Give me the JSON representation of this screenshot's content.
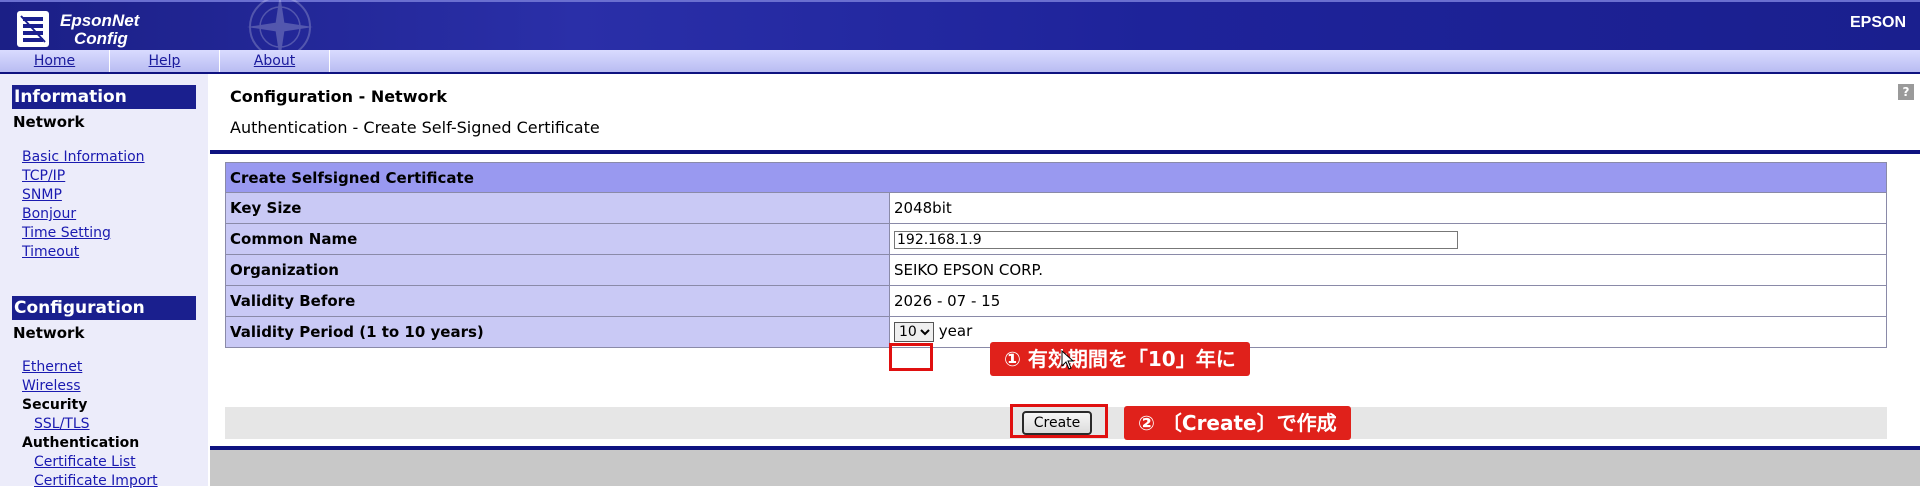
{
  "header": {
    "logo_line1": "EpsonNet",
    "logo_line2": "Config",
    "brand": "EPSON"
  },
  "nav": {
    "items": [
      {
        "label": "Home"
      },
      {
        "label": "Help"
      },
      {
        "label": "About"
      }
    ]
  },
  "sidebar": {
    "information": {
      "title": "Information",
      "section": "Network",
      "links": [
        "Basic Information",
        "TCP/IP",
        "SNMP",
        "Bonjour",
        "Time Setting",
        "Timeout"
      ]
    },
    "configuration": {
      "title": "Configuration",
      "section": "Network",
      "links": [
        "Ethernet",
        "Wireless"
      ],
      "security_label": "Security",
      "ssl_link": "SSL/TLS",
      "authentication_label": "Authentication",
      "auth_links": [
        "Certificate List",
        "Certificate Import"
      ]
    }
  },
  "main": {
    "title": "Configuration - Network",
    "subtitle": "Authentication - Create Self-Signed Certificate",
    "help_icon": "?",
    "table": {
      "header": "Create Selfsigned Certificate",
      "rows": [
        {
          "label": "Key Size",
          "value": "2048bit"
        },
        {
          "label": "Common Name",
          "value": "192.168.1.9"
        },
        {
          "label": "Organization",
          "value": "SEIKO EPSON CORP."
        },
        {
          "label": "Validity Before",
          "value": "2026 - 07 - 15"
        },
        {
          "label": "Validity Period (1 to 10 years)",
          "value": "10",
          "unit": "year"
        }
      ]
    },
    "create_button": "Create",
    "callout1": "① 有効期間を「10」年に",
    "callout2": "② 〔Create〕で作成"
  },
  "colors": {
    "header_blue": "#1a1f8e",
    "table_header": "#9999f0",
    "label_cell": "#c9c9f5",
    "callout_red": "#e0211b"
  },
  "icons": {
    "logo": "epson-logo-icon",
    "help": "help-icon",
    "select_arrow": "chevron-down-icon",
    "cursor": "mouse-pointer-icon"
  }
}
